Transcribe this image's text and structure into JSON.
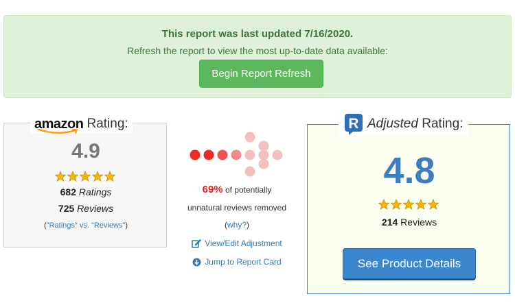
{
  "notice": {
    "title": "This report was last updated 7/16/2020.",
    "subtitle": "Refresh the report to view the most up-to-date data available:",
    "button_label": "Begin Report Refresh",
    "bg_color": "#dff0d8",
    "button_color": "#5cb85c"
  },
  "amazon": {
    "logo_text": "amazon",
    "title": "Rating:",
    "score": "4.9",
    "stars": 5,
    "ratings_count": "682",
    "ratings_label": "Ratings",
    "reviews_count": "725",
    "reviews_label": "Reviews",
    "link_open": "(",
    "link_text": "\"Ratings\" vs. \"Reviews\"",
    "link_close": ")"
  },
  "middle": {
    "percent": "69%",
    "text1": "of potentially",
    "text2": "unnatural reviews removed",
    "why_open": "(",
    "why_link": "why?",
    "why_close": ")",
    "edit_label": "View/Edit Adjustment",
    "edit_icon": "edit-icon",
    "jump_label": "Jump to Report Card",
    "jump_icon": "arrow-circle-down-icon"
  },
  "adjusted": {
    "title_italic": "Adjusted",
    "title_rest": "Rating:",
    "score": "4.8",
    "stars": 5,
    "reviews_count": "214",
    "reviews_label": "Reviews",
    "button_label": "See Product Details",
    "accent_color": "#3d7ec1"
  }
}
